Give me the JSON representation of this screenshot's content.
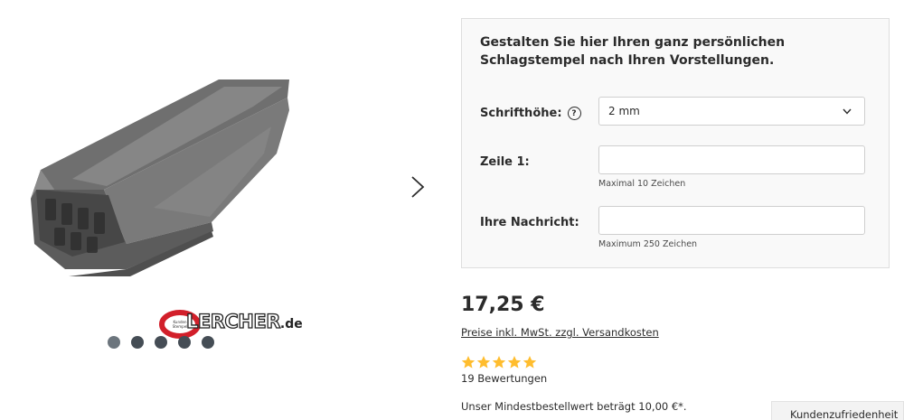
{
  "gallery": {
    "image_alt": "Schlagstempel",
    "logo_text": "LERCHER",
    "logo_domain": ".de",
    "slide_count": 5,
    "active_slide": 1
  },
  "configurator": {
    "title": "Gestalten Sie hier Ihren ganz persönlichen Schlagstempel nach Ihren Vorstellungen.",
    "font_height": {
      "label": "Schrifthöhe:",
      "help_icon": "question-circle-icon",
      "value": "2 mm"
    },
    "line1": {
      "label": "Zeile 1:",
      "value": "",
      "hint": "Maximal 10 Zeichen"
    },
    "message": {
      "label": "Ihre Nachricht:",
      "value": "",
      "hint": "Maximum 250 Zeichen"
    }
  },
  "price": {
    "amount": "17,25 €",
    "note": "Preise inkl. MwSt. zzgl. Versandkosten"
  },
  "rating": {
    "stars": 5,
    "max_stars": 5,
    "star_color": "#ffbd2e",
    "count_label": "19 Bewertungen"
  },
  "min_order": "Unser Mindestbestellwert beträgt 10,00 €*.",
  "satisfaction_tab": "Kundenzufriedenheit"
}
